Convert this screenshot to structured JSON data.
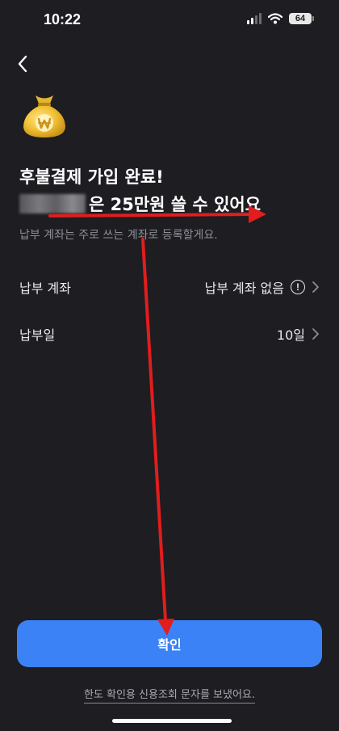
{
  "status_bar": {
    "time": "10:22",
    "battery": "64"
  },
  "header": {
    "back_icon": "chevron-left-icon"
  },
  "hero": {
    "icon": "money-bag-icon",
    "title_line1": "후불결제 가입 완료!",
    "title_line2": "은 25만원 쓸 수 있어요",
    "subtext": "납부 계좌는 주로 쓰는 계좌로 등록할게요."
  },
  "rows": [
    {
      "label": "납부 계좌",
      "value": "납부 계좌 없음"
    },
    {
      "label": "납부일",
      "value": "10일"
    }
  ],
  "confirm_button": {
    "label": "확인"
  },
  "footnote": "한도 확인용 신용조회 문자를 보냈어요.",
  "colors": {
    "background": "#1d1d22",
    "accent": "#3b82f6",
    "annotation": "#e11d1d"
  }
}
